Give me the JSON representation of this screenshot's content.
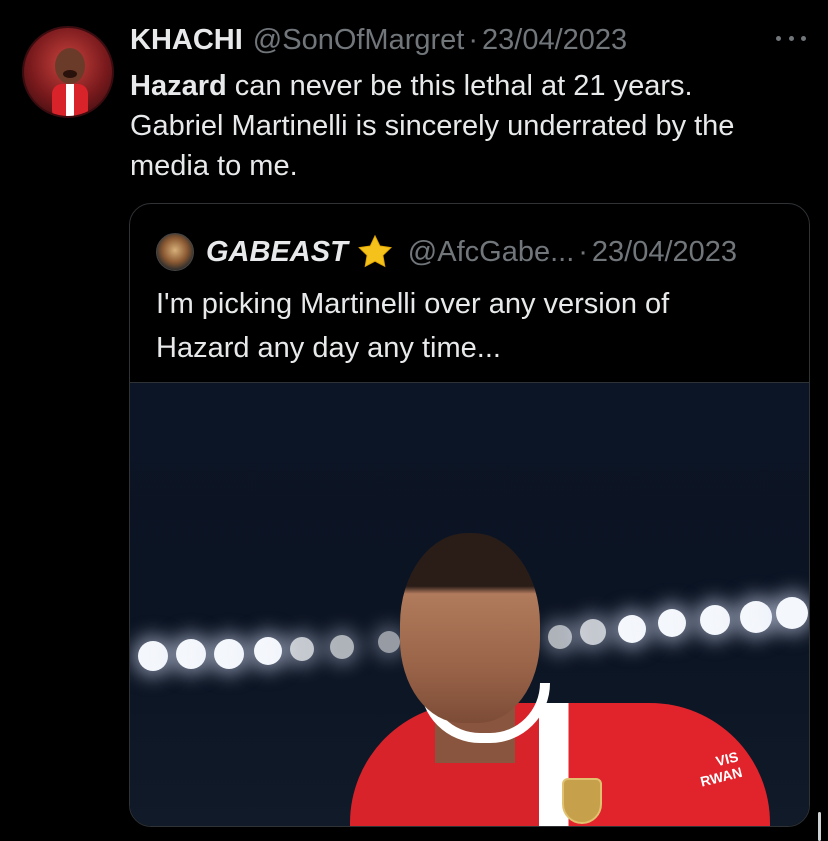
{
  "tweet": {
    "author_name": "KHACHI",
    "handle": "@SonOfMargret",
    "separator": "·",
    "date": "23/04/2023",
    "text_bold": "Hazard",
    "text_line1_rest": " can never be this lethal at 21 years.",
    "text_line2": "Gabriel Martinelli is sincerely underrated by the",
    "text_line3": "media to me."
  },
  "quote": {
    "author_name": "GABEAST",
    "badge_icon": "star-icon",
    "handle": "@AfcGabe...",
    "separator": "·",
    "date": "23/04/2023",
    "text_line1": "I'm picking Martinelli over any version of",
    "text_line2": "Hazard any day any time...",
    "media": {
      "sponsor_line1": "VIS",
      "sponsor_line2": "RWAN"
    }
  },
  "icons": {
    "more": "more-options-icon",
    "star": "star-icon"
  },
  "colors": {
    "background": "#000000",
    "text_primary": "#e7e9ea",
    "text_secondary": "#71767b",
    "border": "#2f3336",
    "star": "#f5c21b"
  }
}
